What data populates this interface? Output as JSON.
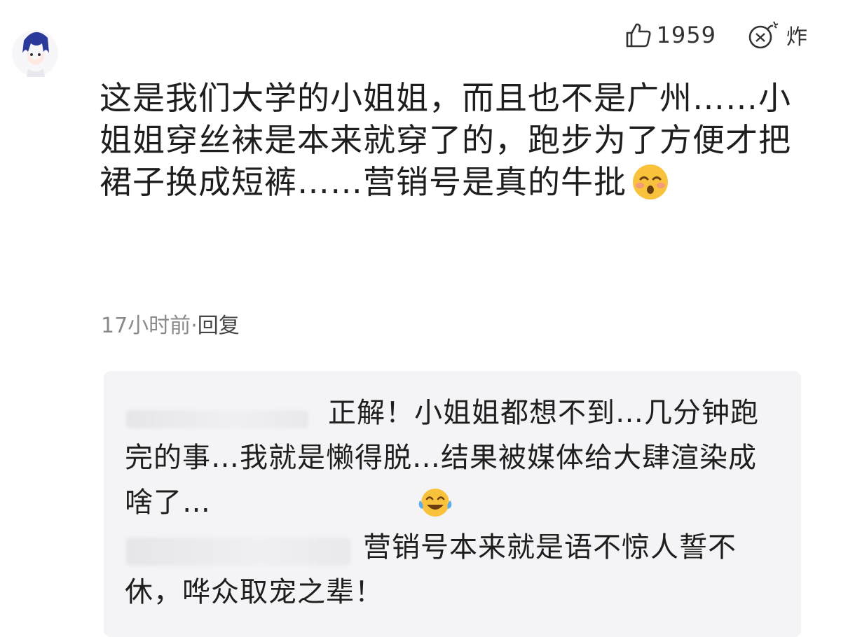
{
  "comment": {
    "avatar_icon": "anime-boy-avatar-icon",
    "like_icon": "thumbs-up-icon",
    "like_count": "1959",
    "bomb_icon": "bomb-icon",
    "bomb_label": "炸",
    "text": "这是我们大学的小姐姐，而且也不是广州……小姐姐穿丝袜是本来就穿了的，跑步为了方便才把裙子换成短裤……营销号是真的牛批",
    "emoji_icon": "blushing-face-emoji-icon",
    "time": "17小时前",
    "separator": "·",
    "reply_label": "回复"
  },
  "replies": [
    {
      "text": "正解！小姐姐都想不到…几分钟跑完的事…我就是懒得脱…结果被媒体给大肆渲染成啥了…",
      "emoji_icon": "tears-of-joy-emoji-icon"
    },
    {
      "text": "营销号本来就是语不惊人誓不休，哗众取宠之辈！"
    }
  ]
}
